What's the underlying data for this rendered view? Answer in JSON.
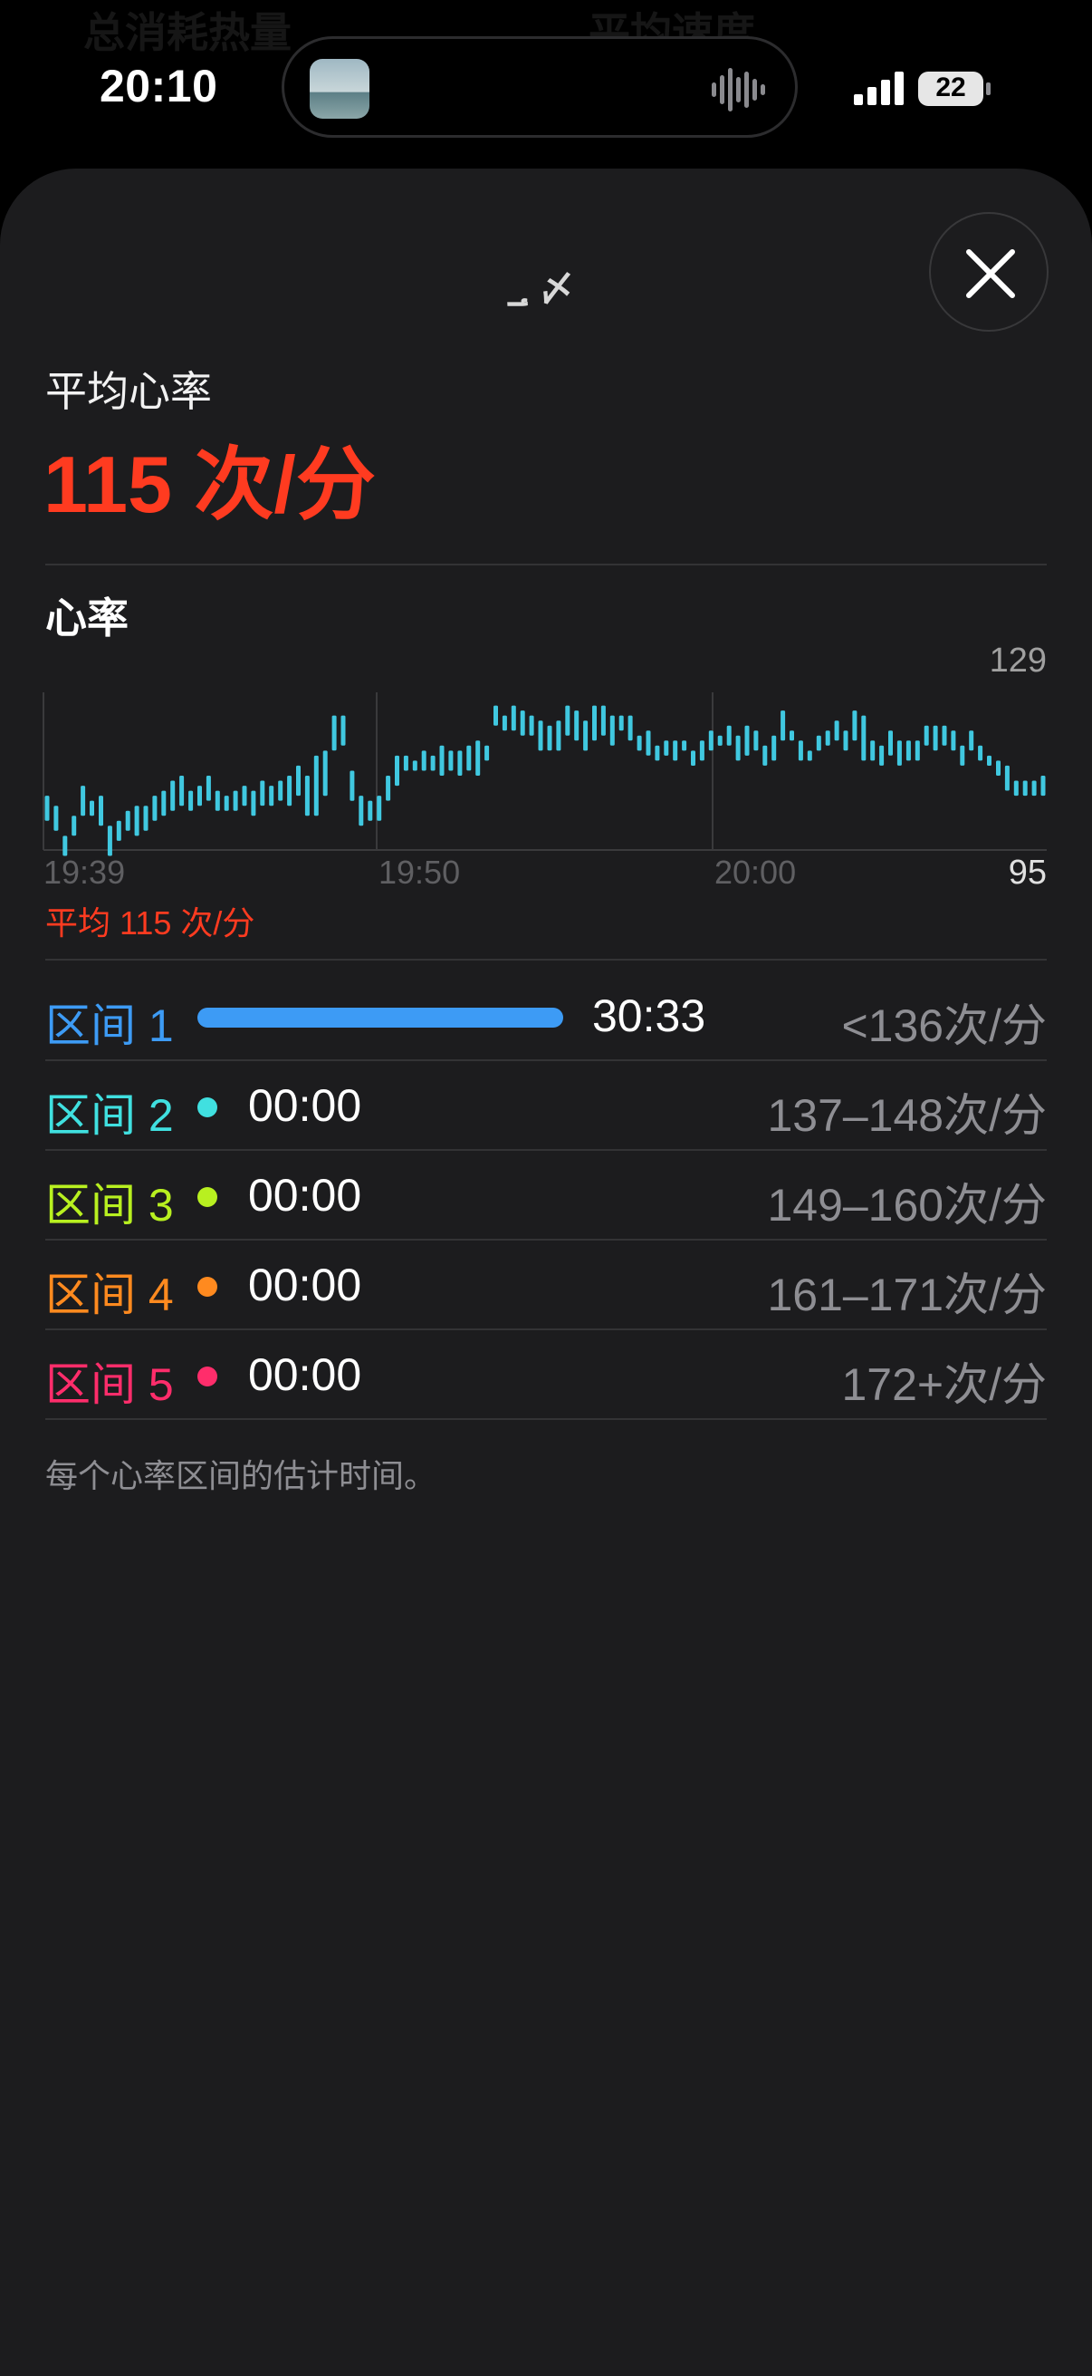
{
  "status_bar": {
    "time": "20:10",
    "battery": "22",
    "background_hints": [
      "总消耗热量",
      "平均速度"
    ]
  },
  "sheet": {
    "header_text": "؀ 〆",
    "close_icon": "close-icon",
    "average_heart_rate": {
      "label": "平均心率",
      "value": "115 次/分"
    },
    "section_title": "心率",
    "chart": {
      "max_label": "129",
      "min_label": "95",
      "x_ticks": [
        "19:39",
        "19:50",
        "20:00"
      ],
      "average_label": "平均 115 次/分"
    },
    "zones": [
      {
        "name": "区间 1",
        "time": "30:33",
        "range": "<136次/分",
        "color": "#3d9bf5"
      },
      {
        "name": "区间 2",
        "time": "00:00",
        "range": "137–148次/分",
        "color": "#40e0e0"
      },
      {
        "name": "区间 3",
        "time": "00:00",
        "range": "149–160次/分",
        "color": "#b8f020"
      },
      {
        "name": "区间 4",
        "time": "00:00",
        "range": "161–171次/分",
        "color": "#ff8a1f"
      },
      {
        "name": "区间 5",
        "time": "00:00",
        "range": "172+次/分",
        "color": "#ff2d6b"
      }
    ],
    "footnote": "每个心率区间的估计时间。"
  },
  "chart_data": {
    "type": "bar",
    "title": "心率",
    "x_range": [
      "19:39",
      "20:10"
    ],
    "x_ticks": [
      "19:39",
      "19:50",
      "20:00"
    ],
    "ylim": [
      95,
      129
    ],
    "average": 115,
    "color": "#40c8e0",
    "ranges": [
      [
        103,
        108
      ],
      [
        101,
        106
      ],
      [
        96,
        100
      ],
      [
        100,
        104
      ],
      [
        104,
        110
      ],
      [
        104,
        107
      ],
      [
        102,
        108
      ],
      [
        96,
        102
      ],
      [
        99,
        103
      ],
      [
        101,
        105
      ],
      [
        100,
        106
      ],
      [
        101,
        106
      ],
      [
        103,
        108
      ],
      [
        104,
        109
      ],
      [
        105,
        111
      ],
      [
        106,
        112
      ],
      [
        105,
        109
      ],
      [
        106,
        110
      ],
      [
        107,
        112
      ],
      [
        105,
        109
      ],
      [
        105,
        108
      ],
      [
        105,
        109
      ],
      [
        106,
        110
      ],
      [
        104,
        109
      ],
      [
        106,
        111
      ],
      [
        106,
        110
      ],
      [
        107,
        111
      ],
      [
        106,
        112
      ],
      [
        108,
        114
      ],
      [
        104,
        112
      ],
      [
        104,
        116
      ],
      [
        108,
        117
      ],
      [
        117,
        124
      ],
      [
        118,
        124
      ],
      [
        107,
        113
      ],
      [
        102,
        108
      ],
      [
        103,
        107
      ],
      [
        103,
        108
      ],
      [
        107,
        112
      ],
      [
        110,
        116
      ],
      [
        113,
        116
      ],
      [
        113,
        115
      ],
      [
        113,
        117
      ],
      [
        113,
        116
      ],
      [
        112,
        118
      ],
      [
        113,
        117
      ],
      [
        112,
        117
      ],
      [
        113,
        118
      ],
      [
        112,
        119
      ],
      [
        115,
        118
      ],
      [
        122,
        126
      ],
      [
        121,
        124
      ],
      [
        121,
        126
      ],
      [
        120,
        125
      ],
      [
        120,
        124
      ],
      [
        117,
        123
      ],
      [
        117,
        122
      ],
      [
        117,
        123
      ],
      [
        120,
        126
      ],
      [
        119,
        125
      ],
      [
        117,
        123
      ],
      [
        119,
        126
      ],
      [
        120,
        126
      ],
      [
        118,
        124
      ],
      [
        121,
        124
      ],
      [
        119,
        124
      ],
      [
        117,
        120
      ],
      [
        116,
        121
      ],
      [
        115,
        118
      ],
      [
        116,
        119
      ],
      [
        115,
        119
      ],
      [
        117,
        119
      ],
      [
        114,
        117
      ],
      [
        115,
        119
      ],
      [
        117,
        121
      ],
      [
        118,
        120
      ],
      [
        118,
        122
      ],
      [
        115,
        120
      ],
      [
        116,
        122
      ],
      [
        117,
        121
      ],
      [
        114,
        118
      ],
      [
        115,
        120
      ],
      [
        119,
        125
      ],
      [
        119,
        121
      ],
      [
        115,
        119
      ],
      [
        115,
        117
      ],
      [
        117,
        120
      ],
      [
        118,
        121
      ],
      [
        119,
        123
      ],
      [
        117,
        121
      ],
      [
        119,
        125
      ],
      [
        115,
        124
      ],
      [
        115,
        119
      ],
      [
        114,
        118
      ],
      [
        116,
        121
      ],
      [
        114,
        119
      ],
      [
        115,
        119
      ],
      [
        115,
        119
      ],
      [
        118,
        122
      ],
      [
        117,
        122
      ],
      [
        118,
        122
      ],
      [
        117,
        121
      ],
      [
        114,
        118
      ],
      [
        117,
        121
      ],
      [
        115,
        118
      ],
      [
        114,
        116
      ],
      [
        112,
        115
      ],
      [
        109,
        114
      ],
      [
        108,
        111
      ],
      [
        108,
        111
      ],
      [
        108,
        111
      ],
      [
        108,
        112
      ]
    ]
  }
}
